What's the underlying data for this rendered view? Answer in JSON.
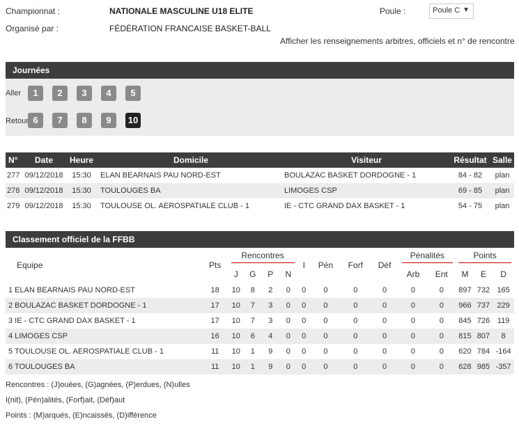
{
  "header": {
    "championnat_label": "Championnat :",
    "championnat_value": "NATIONALE MASCULINE U18 ELITE",
    "organise_label": "Organisé par :",
    "organise_value": "FÉDÉRATION FRANCAISE BASKET-BALL",
    "poule_label": "Poule :",
    "poule_value": "Poule C",
    "link_text": "Afficher les renseignements arbitres, officiels et n° de rencontre"
  },
  "journees": {
    "title": "Journées",
    "aller_label": "Aller",
    "retour_label": "Retour",
    "aller": [
      "1",
      "2",
      "3",
      "4",
      "5"
    ],
    "retour": [
      "6",
      "7",
      "8",
      "9",
      "10"
    ],
    "active": "10"
  },
  "matches": {
    "headers": [
      "N°",
      "Date",
      "Heure",
      "Domicile",
      "Visiteur",
      "Résultat",
      "Salle"
    ],
    "rows": [
      {
        "num": "277",
        "date": "09/12/2018",
        "heure": "15:30",
        "domicile": "ELAN BEARNAIS PAU NORD-EST",
        "visiteur": "BOULAZAC BASKET DORDOGNE - 1",
        "resultat": "84 - 82",
        "salle": "plan"
      },
      {
        "num": "278",
        "date": "09/12/2018",
        "heure": "15:30",
        "domicile": "TOULOUGES BA",
        "visiteur": "LIMOGES CSP",
        "resultat": "69 - 85",
        "salle": "plan"
      },
      {
        "num": "279",
        "date": "09/12/2018",
        "heure": "15:30",
        "domicile": "TOULOUSE OL. AEROSPATIALE CLUB - 1",
        "visiteur": "IE - CTC GRAND DAX BASKET - 1",
        "resultat": "54 - 75",
        "salle": "plan"
      }
    ]
  },
  "classement": {
    "title": "Classement officiel de la FFBB",
    "h_equipe": "Equipe",
    "h_pts": "Pts",
    "h_rencontres": "Rencontres",
    "h_j": "J",
    "h_g": "G",
    "h_p": "P",
    "h_n": "N",
    "h_i": "I",
    "h_pen": "Pén",
    "h_forf": "Forf",
    "h_def": "Déf",
    "h_penalites": "Pénalités",
    "h_arb": "Arb",
    "h_ent": "Ent",
    "h_points": "Points",
    "h_m": "M",
    "h_e": "E",
    "h_d": "D",
    "rows": [
      {
        "equipe": "1 ELAN BEARNAIS PAU NORD-EST",
        "pts": "18",
        "j": "10",
        "g": "8",
        "p": "2",
        "n": "0",
        "i": "0",
        "pen": "0",
        "forf": "0",
        "def": "0",
        "arb": "0",
        "ent": "0",
        "m": "897",
        "e": "732",
        "d": "165"
      },
      {
        "equipe": "2 BOULAZAC BASKET DORDOGNE - 1",
        "pts": "17",
        "j": "10",
        "g": "7",
        "p": "3",
        "n": "0",
        "i": "0",
        "pen": "0",
        "forf": "0",
        "def": "0",
        "arb": "0",
        "ent": "0",
        "m": "966",
        "e": "737",
        "d": "229"
      },
      {
        "equipe": "3 IE - CTC GRAND DAX BASKET - 1",
        "pts": "17",
        "j": "10",
        "g": "7",
        "p": "3",
        "n": "0",
        "i": "0",
        "pen": "0",
        "forf": "0",
        "def": "0",
        "arb": "0",
        "ent": "0",
        "m": "845",
        "e": "726",
        "d": "119"
      },
      {
        "equipe": "4 LIMOGES CSP",
        "pts": "16",
        "j": "10",
        "g": "6",
        "p": "4",
        "n": "0",
        "i": "0",
        "pen": "0",
        "forf": "0",
        "def": "0",
        "arb": "0",
        "ent": "0",
        "m": "815",
        "e": "807",
        "d": "8"
      },
      {
        "equipe": "5 TOULOUSE OL. AEROSPATIALE CLUB - 1",
        "pts": "11",
        "j": "10",
        "g": "1",
        "p": "9",
        "n": "0",
        "i": "0",
        "pen": "0",
        "forf": "0",
        "def": "0",
        "arb": "0",
        "ent": "0",
        "m": "620",
        "e": "784",
        "d": "-164"
      },
      {
        "equipe": "6 TOULOUGES BA",
        "pts": "11",
        "j": "10",
        "g": "1",
        "p": "9",
        "n": "0",
        "i": "0",
        "pen": "0",
        "forf": "0",
        "def": "0",
        "arb": "0",
        "ent": "0",
        "m": "628",
        "e": "985",
        "d": "-357"
      }
    ]
  },
  "legend": {
    "line1": "Rencontres : (J)ouées, (G)agnées, (P)erdues, (N)ulles",
    "line2": "I(nit), (Pén)alités, (Forf)ait, (Déf)aut",
    "line3": "Points : (M)arqués, (E)ncaissés, (D)ifférence"
  }
}
